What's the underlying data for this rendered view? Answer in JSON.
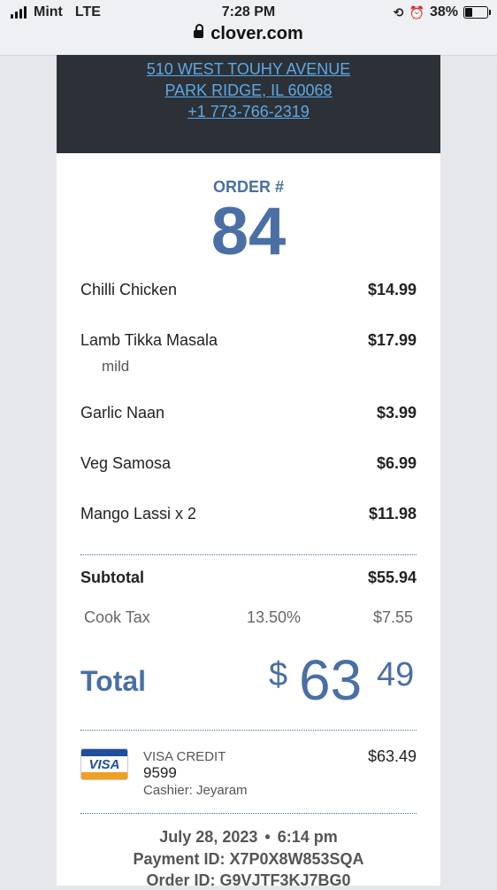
{
  "status_bar": {
    "carrier": "Mint",
    "network": "LTE",
    "time": "7:28 PM",
    "battery": "38%",
    "battery_level": 0.38,
    "url": "clover.com"
  },
  "merchant": {
    "address_line1": "510 WEST TOUHY AVENUE",
    "address_line2": "PARK RIDGE, IL 60068",
    "phone": "+1 773-766-2319"
  },
  "order": {
    "label": "ORDER #",
    "number": "84"
  },
  "items": [
    {
      "name": "Chilli Chicken",
      "price": "$14.99",
      "modifier": ""
    },
    {
      "name": "Lamb Tikka Masala",
      "price": "$17.99",
      "modifier": "mild"
    },
    {
      "name": "Garlic Naan",
      "price": "$3.99",
      "modifier": ""
    },
    {
      "name": "Veg Samosa",
      "price": "$6.99",
      "modifier": ""
    },
    {
      "name": "Mango Lassi x 2",
      "price": "$11.98",
      "modifier": ""
    }
  ],
  "subtotal": {
    "label": "Subtotal",
    "value": "$55.94"
  },
  "tax": {
    "label": "Cook Tax",
    "rate": "13.50%",
    "amount": "$7.55"
  },
  "total": {
    "label": "Total",
    "currency": "$",
    "whole": "63",
    "cents": "49"
  },
  "payment": {
    "card_brand": "VISA",
    "type": "VISA CREDIT",
    "last4": "9599",
    "cashier": "Cashier: Jeyaram",
    "amount": "$63.49"
  },
  "footer": {
    "date": "July 28, 2023",
    "time": "6:14 pm",
    "payment_id": "Payment ID: X7P0X8W853SQA",
    "order_id": "Order ID: G9VJTF3KJ7BG0"
  },
  "colors": {
    "accent": "#4a6fa5",
    "header_bg": "#2b3136",
    "link": "#5fa8e6"
  }
}
